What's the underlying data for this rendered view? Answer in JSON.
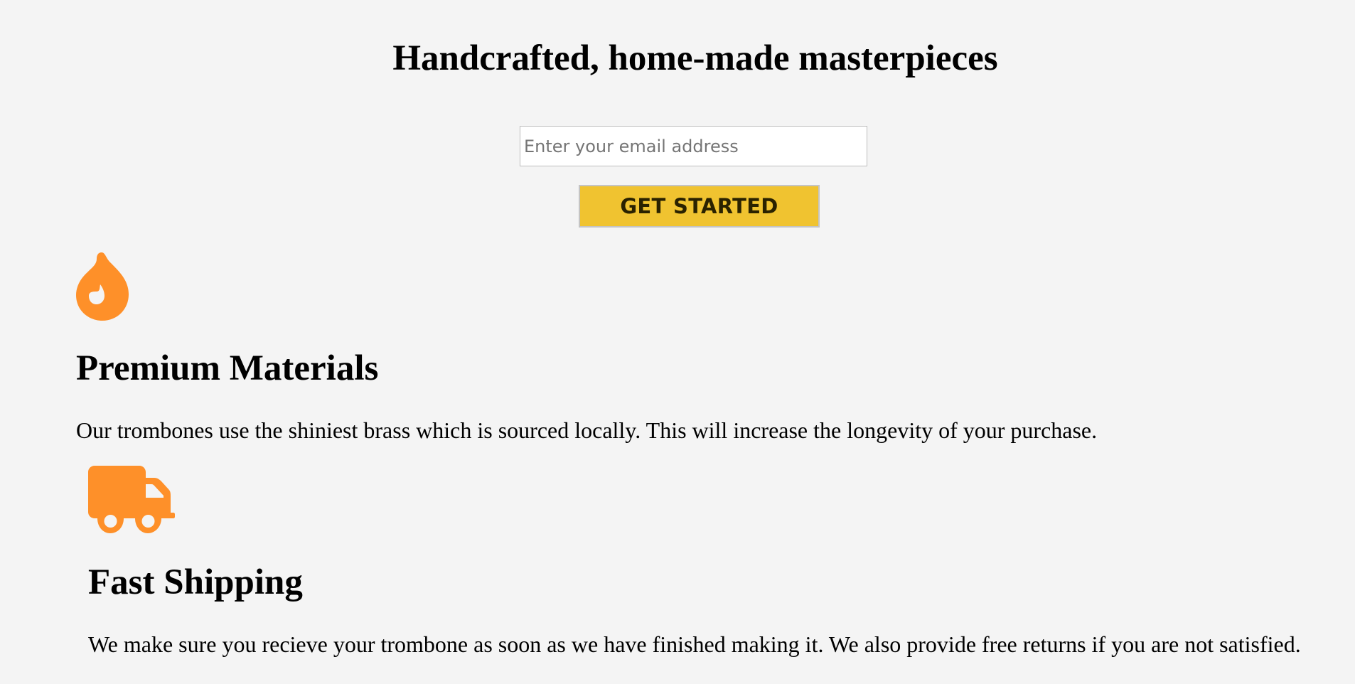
{
  "hero": {
    "title": "Handcrafted, home-made masterpieces"
  },
  "signup": {
    "email_placeholder": "Enter your email address",
    "email_value": "",
    "button_label": "GET STARTED"
  },
  "features": [
    {
      "icon": "flame-icon",
      "title": "Premium Materials",
      "text": "Our trombones use the shiniest brass which is sourced locally. This will increase the longevity of your purchase."
    },
    {
      "icon": "truck-icon",
      "title": "Fast Shipping",
      "text": "We make sure you recieve your trombone as soon as we have finished making it. We also provide free returns if you are not satisfied."
    }
  ],
  "colors": {
    "background": "#f4f4f4",
    "accent_orange": "#fe9029",
    "button_yellow": "#f0c330"
  }
}
